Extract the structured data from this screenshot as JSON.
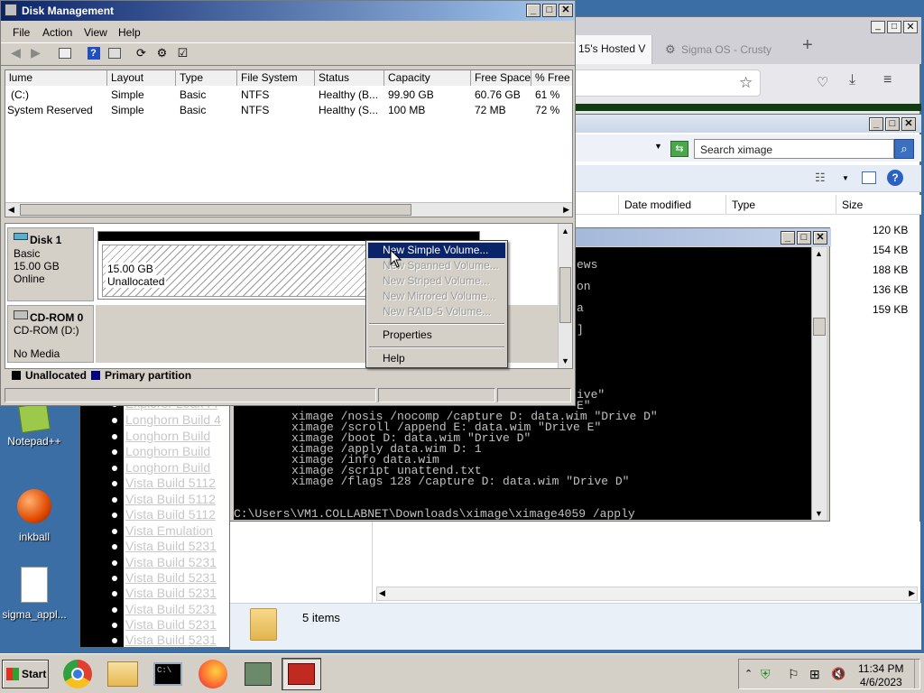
{
  "desktop": {
    "icons": [
      {
        "label": "Notepad++"
      },
      {
        "label": "inkball"
      },
      {
        "label": "sigma_appl..."
      }
    ]
  },
  "browser": {
    "tabs": [
      {
        "label": "15's Hosted V"
      },
      {
        "label": "Sigma OS - Crusty"
      }
    ],
    "new_tab": "+"
  },
  "background_list": {
    "items": [
      "Explorer Leak Fi",
      "Longhorn Build 4",
      "Longhorn Build",
      "Longhorn Build",
      "Longhorn Build",
      "Vista Build 5112",
      "Vista Build 5112",
      "Vista Build 5112",
      "Vista Emulation",
      "Vista Build 5231",
      "Vista Build 5231",
      "Vista Build 5231",
      "Vista Build 5231",
      "Vista Build 5231",
      "Vista Build 5231",
      "Vista Build 5231"
    ]
  },
  "explorer": {
    "search_placeholder": "Search ximage",
    "columns": [
      "Date modified",
      "Type",
      "Size"
    ],
    "sizes": [
      "120 KB",
      "154 KB",
      "188 KB",
      "136 KB",
      "159 KB"
    ],
    "status": "5 items"
  },
  "cmd": {
    "partial_lines": [
      "ews",
      "on",
      "a",
      "]"
    ],
    "lines": [
      "ive\"",
      "E\"",
      "ximage /nosis /nocomp /capture D: data.wim \"Drive D\"",
      "ximage /scroll /append E: data.wim \"Drive E\"",
      "ximage /boot D: data.wim \"Drive D\"",
      "ximage /apply data.wim D: 1",
      "ximage /info data.wim",
      "ximage /script unattend.txt",
      "ximage /flags 128 /capture D: data.wim \"Drive D\""
    ],
    "prompt": "C:\\Users\\VM1.COLLABNET\\Downloads\\ximage\\ximage4059 /apply"
  },
  "disk_mgmt": {
    "title": "Disk Management",
    "menu": [
      "File",
      "Action",
      "View",
      "Help"
    ],
    "columns": [
      "lume",
      "Layout",
      "Type",
      "File System",
      "Status",
      "Capacity",
      "Free Space",
      "% Free"
    ],
    "rows": [
      [
        "(C:)",
        "Simple",
        "Basic",
        "NTFS",
        "Healthy (B...",
        "99.90 GB",
        "60.76 GB",
        "61 %"
      ],
      [
        "System Reserved",
        "Simple",
        "Basic",
        "NTFS",
        "Healthy (S...",
        "100 MB",
        "72 MB",
        "72 %"
      ]
    ],
    "disk1": {
      "name": "Disk 1",
      "type": "Basic",
      "size": "15.00 GB",
      "state": "Online",
      "part_size": "15.00 GB",
      "part_label": "Unallocated"
    },
    "cdrom": {
      "name": "CD-ROM 0",
      "drive": "CD-ROM (D:)",
      "media": "No Media"
    },
    "legend": {
      "unallocated": "Unallocated",
      "primary": "Primary partition"
    },
    "legend_colors": {
      "unallocated": "#000000",
      "primary": "#000080"
    }
  },
  "context_menu": {
    "items": [
      {
        "label": "New Simple Volume...",
        "state": "highlighted"
      },
      {
        "label": "New Spanned Volume...",
        "state": "disabled"
      },
      {
        "label": "New Striped Volume...",
        "state": "disabled"
      },
      {
        "label": "New Mirrored Volume...",
        "state": "disabled"
      },
      {
        "label": "New RAID-5 Volume...",
        "state": "disabled"
      },
      {
        "label": "Properties",
        "state": "enabled"
      },
      {
        "label": "Help",
        "state": "enabled"
      }
    ]
  },
  "taskbar": {
    "start": "Start",
    "time": "11:34 PM",
    "date": "4/6/2023"
  },
  "colors": {
    "desktop": "#3a6ea5",
    "highlight": "#0a246a",
    "title_gradient_start": "#0a246a"
  }
}
